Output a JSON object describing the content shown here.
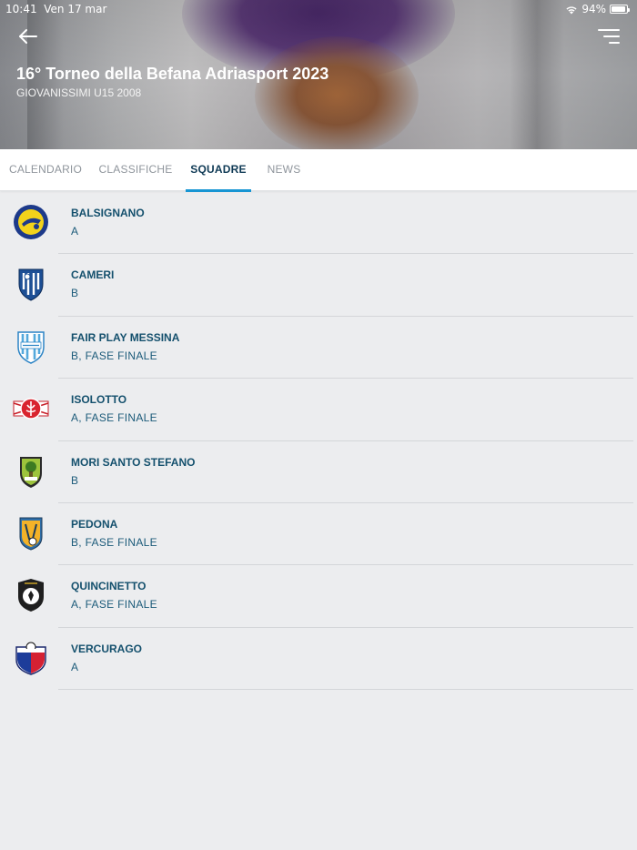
{
  "status_bar": {
    "time": "10:41",
    "date": "Ven 17 mar",
    "battery": "94%",
    "battery_level": 0.94
  },
  "header": {
    "title": "16° Torneo della Befana Adriasport 2023",
    "subtitle": "GIOVANISSIMI U15 2008"
  },
  "tabs": [
    {
      "label": "CALENDARIO",
      "active": false
    },
    {
      "label": "CLASSIFICHE",
      "active": false
    },
    {
      "label": "SQUADRE",
      "active": true
    },
    {
      "label": "NEWS",
      "active": false
    }
  ],
  "teams": [
    {
      "name": "BALSIGNANO",
      "group": "A",
      "logo": "balsignano-logo"
    },
    {
      "name": "CAMERI",
      "group": "B",
      "logo": "cameri-logo"
    },
    {
      "name": "FAIR PLAY MESSINA",
      "group": "B, FASE FINALE",
      "logo": "fair-play-messina-logo"
    },
    {
      "name": "ISOLOTTO",
      "group": "A, FASE FINALE",
      "logo": "isolotto-logo"
    },
    {
      "name": "MORI SANTO STEFANO",
      "group": "B",
      "logo": "mori-santo-stefano-logo"
    },
    {
      "name": "PEDONA",
      "group": "B, FASE FINALE",
      "logo": "pedona-logo"
    },
    {
      "name": "QUINCINETTO",
      "group": "A, FASE FINALE",
      "logo": "quincinetto-logo"
    },
    {
      "name": "VERCURAGO",
      "group": "A",
      "logo": "vercurago-logo"
    }
  ],
  "colors": {
    "accent": "#1795d3",
    "team_text": "#14506d",
    "tab_inactive": "#8f959c",
    "background": "#ecedef"
  }
}
